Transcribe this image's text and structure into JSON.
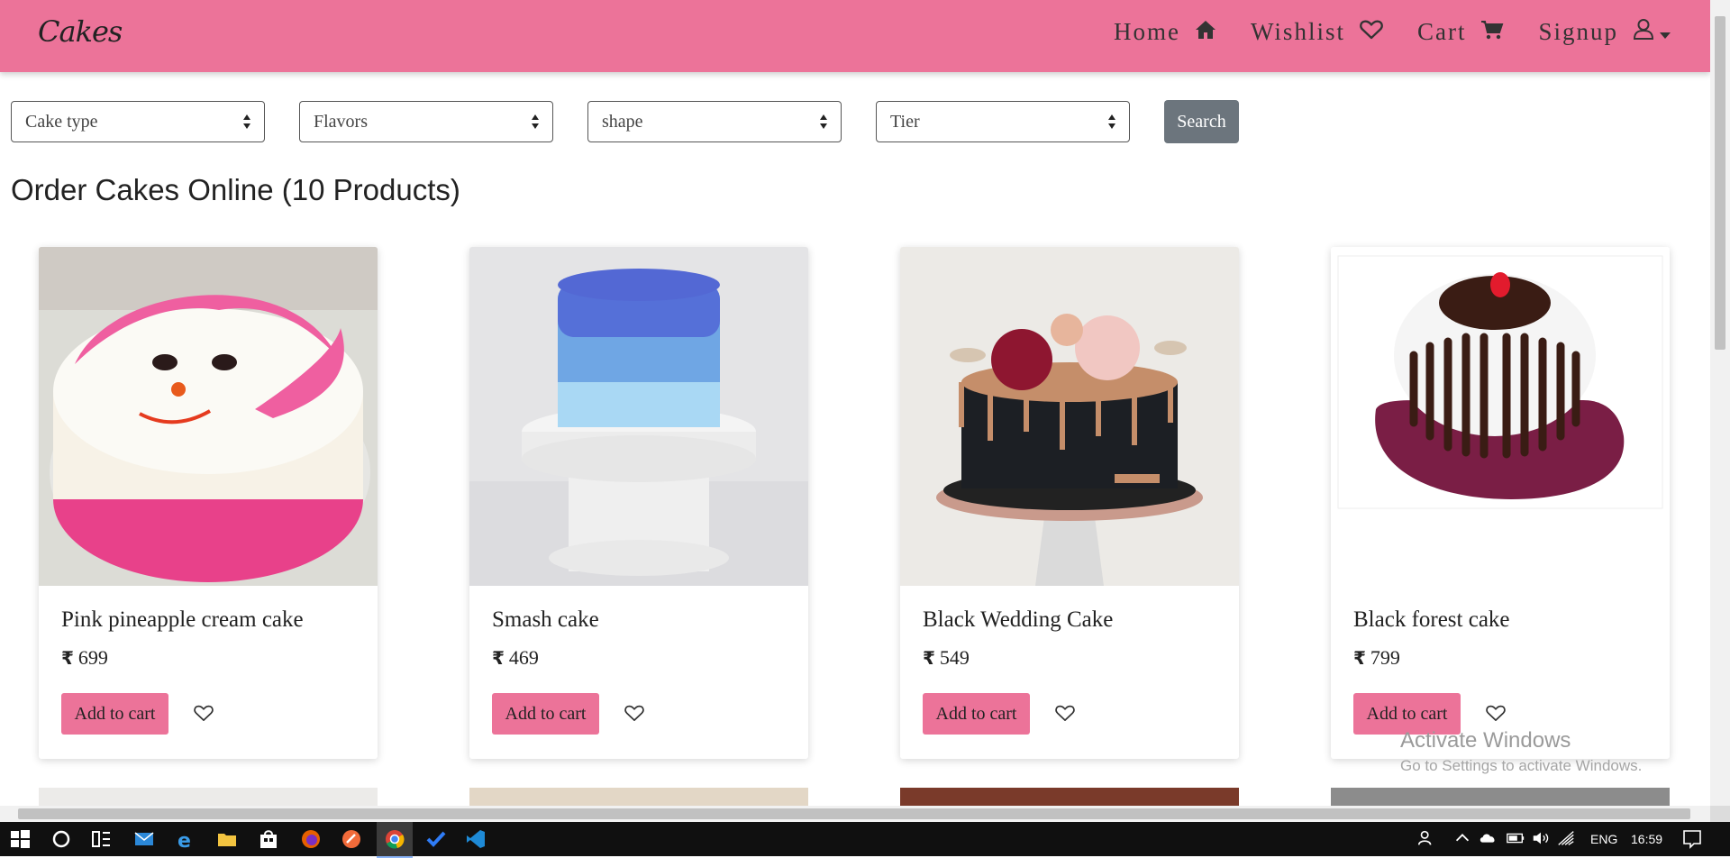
{
  "navbar": {
    "brand": "Cakes",
    "items": [
      {
        "label": "Home",
        "icon": "home-icon"
      },
      {
        "label": "Wishlist",
        "icon": "heart-icon"
      },
      {
        "label": "Cart",
        "icon": "cart-icon"
      },
      {
        "label": "Signup",
        "icon": "user-icon"
      }
    ]
  },
  "filters": {
    "cake_type": "Cake type",
    "flavors": "Flavors",
    "shape": "shape",
    "tier": "Tier",
    "search_label": "Search"
  },
  "heading": "Order Cakes Online (10 Products)",
  "products": [
    {
      "name": "Pink pineapple cream cake",
      "price": "699",
      "button": "Add to cart"
    },
    {
      "name": "Smash cake",
      "price": "469",
      "button": "Add to cart"
    },
    {
      "name": "Black Wedding Cake",
      "price": "549",
      "button": "Add to cart"
    },
    {
      "name": "Black forest cake",
      "price": "799",
      "button": "Add to cart"
    }
  ],
  "currency_symbol": "₹",
  "watermark": {
    "line1": "Activate Windows",
    "line2": "Go to Settings to activate Windows."
  },
  "taskbar": {
    "language": "ENG",
    "time": "16:59"
  },
  "colors": {
    "brand_pink": "#ec7399",
    "search_grey": "#6c757d"
  }
}
